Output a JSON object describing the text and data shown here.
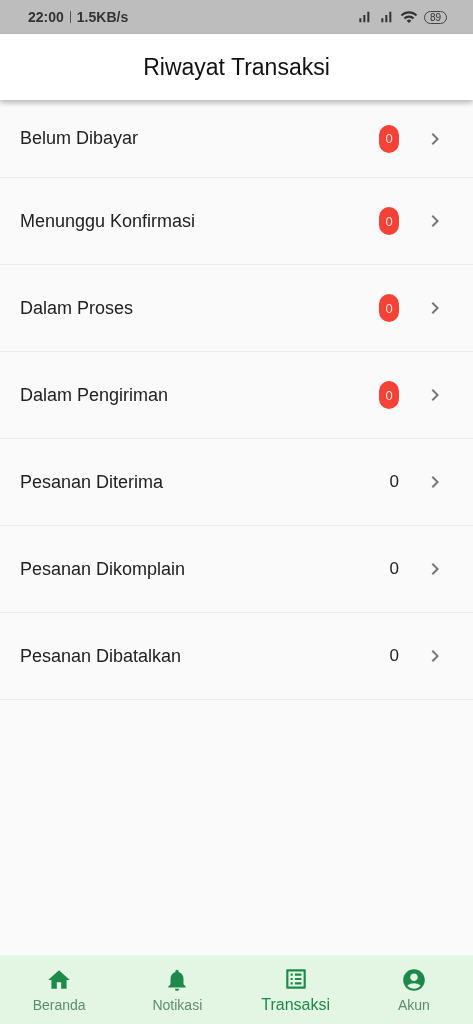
{
  "status_bar": {
    "time": "22:00",
    "speed": "1.5KB/s",
    "battery": "89"
  },
  "header": {
    "title": "Riwayat Transaksi"
  },
  "rows": [
    {
      "label": "Belum Dibayar",
      "count": "0",
      "kind": "badge"
    },
    {
      "label": "Menunggu Konfirmasi",
      "count": "0",
      "kind": "badge"
    },
    {
      "label": "Dalam Proses",
      "count": "0",
      "kind": "badge"
    },
    {
      "label": "Dalam Pengiriman",
      "count": "0",
      "kind": "badge"
    },
    {
      "label": "Pesanan Diterima",
      "count": "0",
      "kind": "plain"
    },
    {
      "label": "Pesanan Dikomplain",
      "count": "0",
      "kind": "plain"
    },
    {
      "label": "Pesanan Dibatalkan",
      "count": "0",
      "kind": "plain"
    }
  ],
  "bottom_nav": [
    {
      "label": "Beranda",
      "kind": "home",
      "selected": false
    },
    {
      "label": "Notikasi",
      "kind": "bell",
      "selected": false
    },
    {
      "label": "Transaksi",
      "kind": "list",
      "selected": true
    },
    {
      "label": "Akun",
      "kind": "account",
      "selected": false
    }
  ]
}
